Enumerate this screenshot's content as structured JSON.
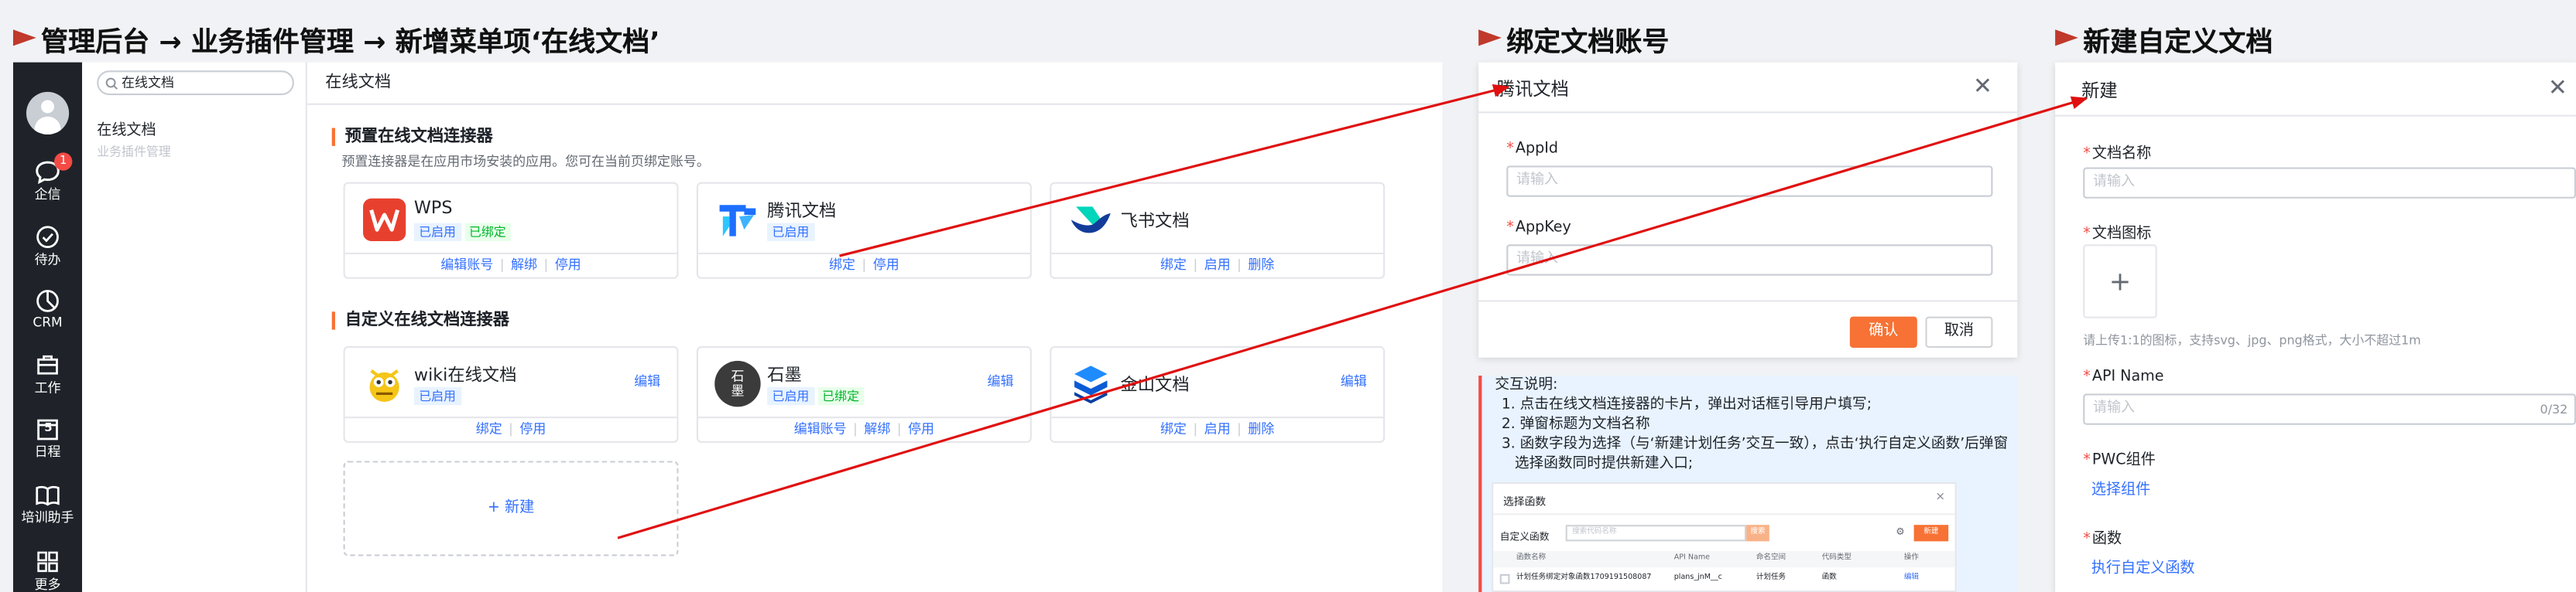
{
  "titles": {
    "admin": "管理后台 → 业务插件管理 → 新增菜单项‘在线文档’",
    "bind": "绑定文档账号",
    "create": "新建自定义文档"
  },
  "sidebar": {
    "items": [
      {
        "label": "企信",
        "badge": "1"
      },
      {
        "label": "待办"
      },
      {
        "label": "CRM"
      },
      {
        "label": "工作"
      },
      {
        "label": "日程",
        "glyph": "5"
      },
      {
        "label": "培训助手"
      },
      {
        "label": "更多"
      }
    ]
  },
  "panel2": {
    "search_value": "在线文档",
    "item": "在线文档",
    "sub": "业务插件管理"
  },
  "main": {
    "title": "在线文档",
    "preset_title": "预置在线文档连接器",
    "preset_desc": "预置连接器是在应用市场安装的应用。您可在当前页绑定账号。",
    "custom_title": "自定义在线文档连接器",
    "new_label": "+ 新建",
    "cards": {
      "wps": {
        "name": "WPS",
        "tags": [
          "已启用",
          "已绑定"
        ],
        "actions": [
          "编辑账号",
          "解绑",
          "停用"
        ]
      },
      "tencent": {
        "name": "腾讯文档",
        "tags": [
          "已启用"
        ],
        "actions": [
          "绑定",
          "停用"
        ]
      },
      "feishu": {
        "name": "飞书文档",
        "tags": [],
        "actions": [
          "绑定",
          "启用",
          "删除"
        ]
      },
      "wiki": {
        "name": "wiki在线文档",
        "tags": [
          "已启用"
        ],
        "edit": "编辑",
        "actions": [
          "绑定",
          "停用"
        ]
      },
      "shimo": {
        "name": "石墨",
        "logo_text": "石墨",
        "tags": [
          "已启用",
          "已绑定"
        ],
        "edit": "编辑",
        "actions": [
          "编辑账号",
          "解绑",
          "停用"
        ]
      },
      "kingsoft": {
        "name": "金山文档",
        "tags": [],
        "edit": "编辑",
        "actions": [
          "绑定",
          "启用",
          "删除"
        ]
      }
    }
  },
  "bind_dialog": {
    "title": "腾讯文档",
    "close": "✕",
    "fields": [
      {
        "label": "AppId",
        "placeholder": "请输入"
      },
      {
        "label": "AppKey",
        "placeholder": "请输入"
      }
    ],
    "confirm": "确认",
    "cancel": "取消"
  },
  "note": {
    "heading": "交互说明:",
    "lines": [
      "1. 点击在线文档连接器的卡片，弹出对话框引导用户填写;",
      "2. 弹窗标题为文档名称",
      "3. 函数字段为选择（与‘新建计划任务’交互一致），点击‘执行自定义函数’后弹窗选择函数同时提供新建入口;"
    ]
  },
  "mini_dialog": {
    "title": "选择函数",
    "close": "✕",
    "label": "自定义函数",
    "input_placeholder": "搜索代码名称",
    "search_btn": "搜索",
    "new_btn": "新建",
    "columns": [
      "函数名称",
      "API Name",
      "命名空间",
      "代码类型",
      "操作"
    ],
    "row": [
      "计划任务绑定对象函数1709191508087",
      "plans_jnM__c",
      "计划任务",
      "函数",
      "编辑"
    ]
  },
  "create_dialog": {
    "title": "新建",
    "close": "✕",
    "name_label": "文档名称",
    "name_placeholder": "请输入",
    "icon_label": "文档图标",
    "icon_plus": "+",
    "icon_hint": "请上传1:1的图标，支持svg、jpg、png格式，大小不超过1m",
    "api_label": "API Name",
    "api_placeholder": "请输入",
    "api_count": "0/32",
    "pwc_label": "PWC组件",
    "pwc_link": "选择组件",
    "func_label": "函数",
    "func_link": "执行自定义函数"
  }
}
